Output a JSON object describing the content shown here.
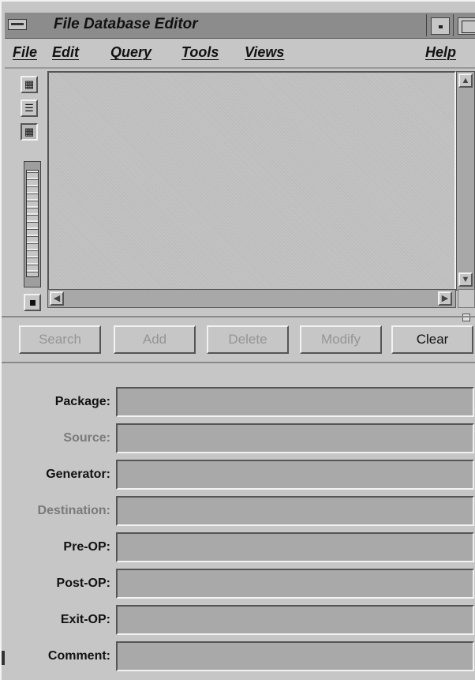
{
  "window": {
    "title": "File Database Editor"
  },
  "menu": {
    "items": [
      "File",
      "Edit",
      "Query",
      "Tools",
      "Views"
    ],
    "help": "Help"
  },
  "toolstrip": {
    "icons": [
      "package-icon",
      "list-view-icon",
      "table-view-icon",
      "zoom-slider",
      "overview-toggle-icon"
    ]
  },
  "buttons": {
    "search": "Search",
    "add": "Add",
    "delete": "Delete",
    "modify": "Modify",
    "clear": "Clear"
  },
  "form": {
    "fields": [
      {
        "label": "Package:",
        "value": "",
        "disabled": false
      },
      {
        "label": "Source:",
        "value": "",
        "disabled": true
      },
      {
        "label": "Generator:",
        "value": "",
        "disabled": false
      },
      {
        "label": "Destination:",
        "value": "",
        "disabled": true
      },
      {
        "label": "Pre-OP:",
        "value": "",
        "disabled": false
      },
      {
        "label": "Post-OP:",
        "value": "",
        "disabled": false
      },
      {
        "label": "Exit-OP:",
        "value": "",
        "disabled": false
      },
      {
        "label": "Comment:",
        "value": "",
        "disabled": false
      }
    ]
  },
  "colors": {
    "window_bg": "#c6c6c6",
    "titlebar": "#8c8c8c",
    "field_bg": "#a9a9a9",
    "disabled_text": "#959595"
  }
}
